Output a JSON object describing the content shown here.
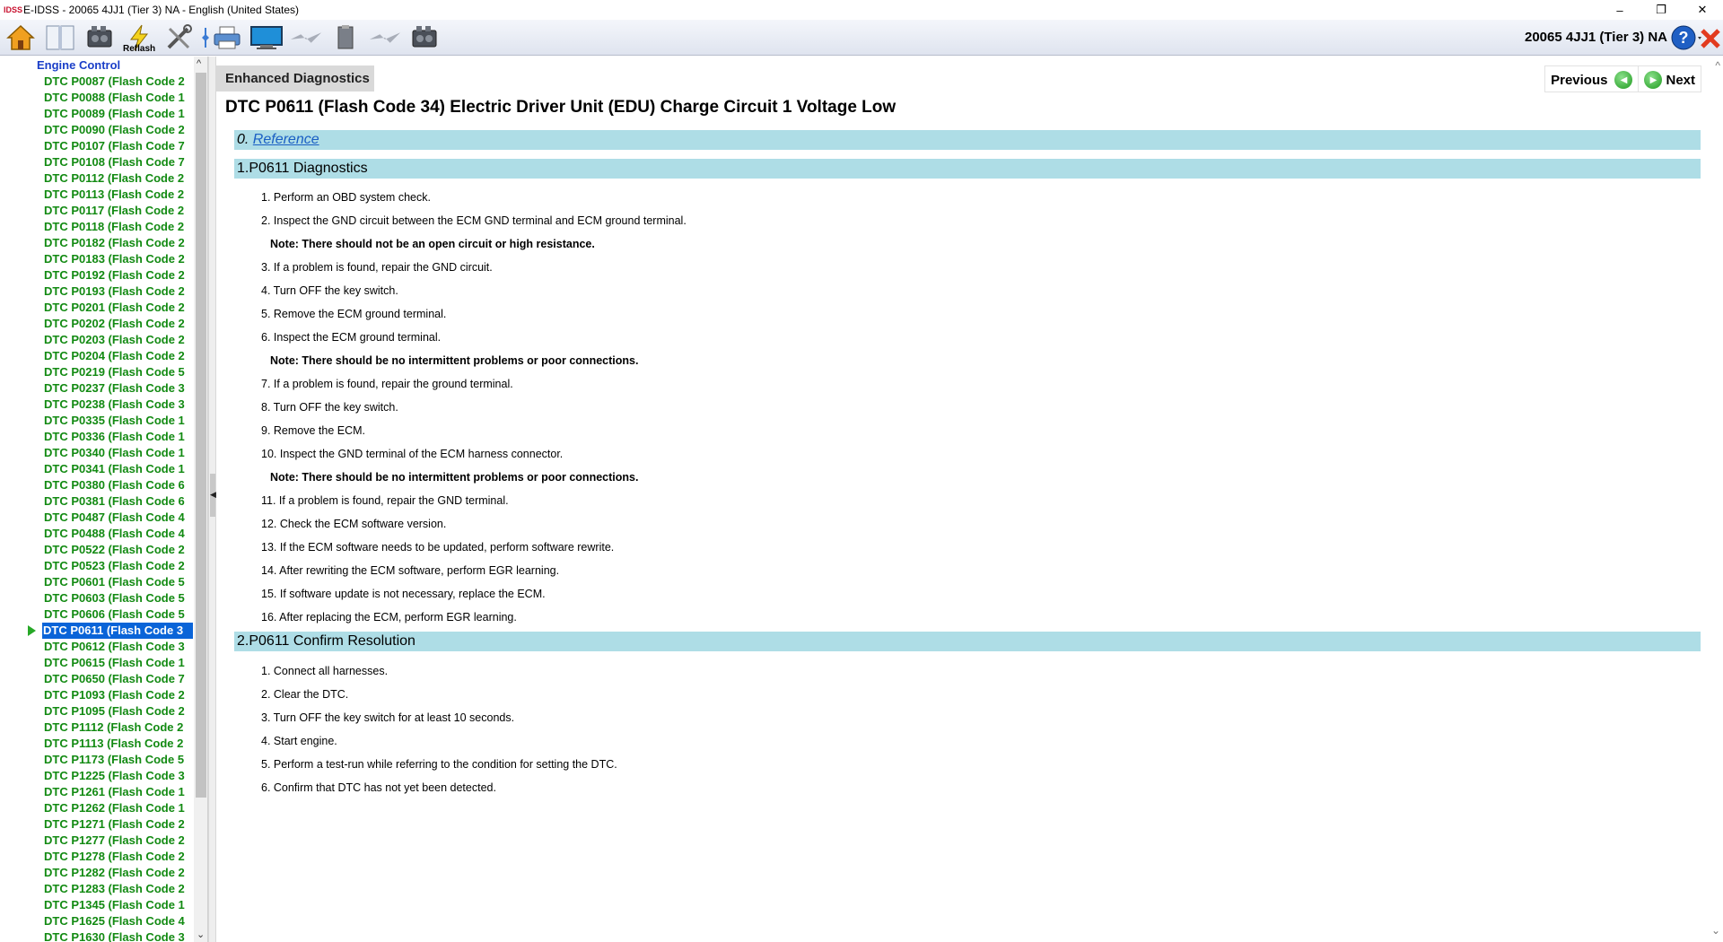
{
  "window": {
    "logo": "IDSS",
    "title": "E-IDSS - 20065 4JJ1 (Tier 3)  NA - English (United States)",
    "minimize": "–",
    "restore": "❐",
    "close": "✕"
  },
  "toolbar": {
    "reflash_label": "Reflash",
    "vehicle_info": "20065 4JJ1 (Tier 3)  NA"
  },
  "sidebar": {
    "header": "Engine Control",
    "items": [
      "DTC P0087 (Flash Code 2",
      "DTC P0088 (Flash Code 1",
      "DTC P0089 (Flash Code 1",
      "DTC P0090 (Flash Code 2",
      "DTC P0107 (Flash Code 7",
      "DTC P0108 (Flash Code 7",
      "DTC P0112 (Flash Code 2",
      "DTC P0113 (Flash Code 2",
      "DTC P0117 (Flash Code 2",
      "DTC P0118 (Flash Code 2",
      "DTC P0182 (Flash Code 2",
      "DTC P0183 (Flash Code 2",
      "DTC P0192 (Flash Code 2",
      "DTC P0193 (Flash Code 2",
      "DTC P0201 (Flash Code 2",
      "DTC P0202 (Flash Code 2",
      "DTC P0203 (Flash Code 2",
      "DTC P0204 (Flash Code 2",
      "DTC P0219 (Flash Code 5",
      "DTC P0237 (Flash Code 3",
      "DTC P0238 (Flash Code 3",
      "DTC P0335 (Flash Code 1",
      "DTC P0336 (Flash Code 1",
      "DTC P0340 (Flash Code 1",
      "DTC P0341 (Flash Code 1",
      "DTC P0380 (Flash Code 6",
      "DTC P0381 (Flash Code 6",
      "DTC P0487 (Flash Code 4",
      "DTC P0488 (Flash Code 4",
      "DTC P0522 (Flash Code 2",
      "DTC P0523 (Flash Code 2",
      "DTC P0601 (Flash Code 5",
      "DTC P0603 (Flash Code 5",
      "DTC P0606 (Flash Code 5",
      "DTC P0611 (Flash Code 3",
      "DTC P0612 (Flash Code 3",
      "DTC P0615 (Flash Code 1",
      "DTC P0650 (Flash Code 7",
      "DTC P1093 (Flash Code 2",
      "DTC P1095 (Flash Code 2",
      "DTC P1112 (Flash Code 2",
      "DTC P1113 (Flash Code 2",
      "DTC P1173 (Flash Code 5",
      "DTC P1225 (Flash Code 3",
      "DTC P1261 (Flash Code 1",
      "DTC P1262 (Flash Code 1",
      "DTC P1271 (Flash Code 2",
      "DTC P1277 (Flash Code 2",
      "DTC P1278 (Flash Code 2",
      "DTC P1282 (Flash Code 2",
      "DTC P1283 (Flash Code 2",
      "DTC P1345 (Flash Code 1",
      "DTC P1625 (Flash Code 4",
      "DTC P1630 (Flash Code 3"
    ],
    "selected_index": 34
  },
  "main": {
    "tab": "Enhanced Diagnostics",
    "previous": "Previous",
    "next": "Next",
    "title": "DTC P0611 (Flash Code 34) Electric Driver Unit (EDU) Charge Circuit 1 Voltage Low",
    "section0_prefix": "0. ",
    "section0_link": "Reference",
    "section1": "1.P0611 Diagnostics",
    "section2": "2.P0611 Confirm Resolution",
    "steps_a": [
      {
        "text": "1. Perform an OBD system check.",
        "note": false
      },
      {
        "text": "2. Inspect the GND circuit between the ECM GND terminal and ECM ground terminal.",
        "note": false
      },
      {
        "text": "Note: There should not be an open circuit or high resistance.",
        "note": true
      },
      {
        "text": "3. If a problem is found, repair the GND circuit.",
        "note": false
      },
      {
        "text": "4. Turn OFF the key switch.",
        "note": false
      },
      {
        "text": "5. Remove the ECM ground terminal.",
        "note": false
      },
      {
        "text": "6. Inspect the ECM ground terminal.",
        "note": false
      },
      {
        "text": "Note: There should be no intermittent problems or poor connections.",
        "note": true
      },
      {
        "text": "7. If a problem is found, repair the ground terminal.",
        "note": false
      },
      {
        "text": "8. Turn OFF the key switch.",
        "note": false
      },
      {
        "text": "9. Remove the ECM.",
        "note": false
      },
      {
        "text": "10. Inspect the GND terminal of the ECM harness connector.",
        "note": false
      },
      {
        "text": "Note: There should be no intermittent problems or poor connections.",
        "note": true
      },
      {
        "text": "11. If a problem is found, repair the GND terminal.",
        "note": false
      },
      {
        "text": "12. Check the ECM software version.",
        "note": false
      },
      {
        "text": "13. If the ECM software needs to be updated, perform software rewrite.",
        "note": false
      },
      {
        "text": "14. After rewriting the ECM software, perform EGR learning.",
        "note": false
      },
      {
        "text": "15. If software update is not necessary, replace the ECM.",
        "note": false
      },
      {
        "text": "16. After replacing the ECM, perform EGR learning.",
        "note": false
      }
    ],
    "steps_b": [
      {
        "text": "1. Connect all harnesses.",
        "note": false
      },
      {
        "text": "2. Clear the DTC.",
        "note": false
      },
      {
        "text": "3. Turn OFF the key switch for at least 10 seconds.",
        "note": false
      },
      {
        "text": "4. Start engine.",
        "note": false
      },
      {
        "text": "5. Perform a test-run while referring to the condition for setting the DTC.",
        "note": false
      },
      {
        "text": "6. Confirm that DTC has not yet been detected.",
        "note": false
      }
    ]
  }
}
